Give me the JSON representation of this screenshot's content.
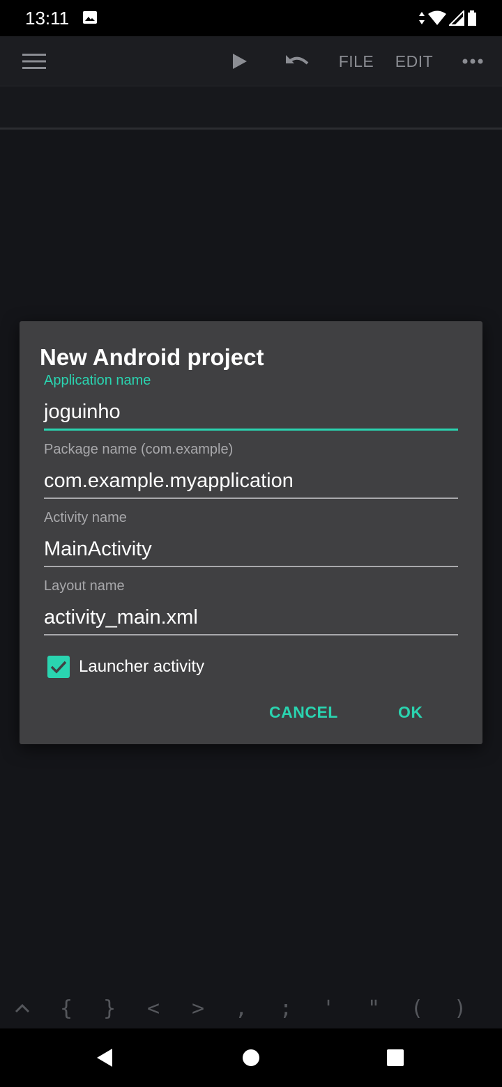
{
  "status_bar": {
    "time": "13:11"
  },
  "toolbar": {
    "file_label": "FILE",
    "edit_label": "EDIT"
  },
  "dialog": {
    "title": "New Android project",
    "fields": [
      {
        "label": "Application name",
        "value": "joguinho",
        "focused": true
      },
      {
        "label": "Package name (com.example)",
        "value": "com.example.myapplication",
        "focused": false
      },
      {
        "label": "Activity name",
        "value": "MainActivity",
        "focused": false
      },
      {
        "label": "Layout name",
        "value": "activity_main.xml",
        "focused": false
      }
    ],
    "launcher_checkbox": {
      "label": "Launcher activity",
      "checked": true
    },
    "cancel_label": "CANCEL",
    "ok_label": "OK"
  },
  "symbol_bar": {
    "symbols": [
      "{",
      "}",
      "<",
      ">",
      ",",
      ";",
      "'",
      "\"",
      "(",
      ")"
    ]
  },
  "colors": {
    "accent": "#2ad4b0",
    "dialog_bg": "#404042",
    "app_bg": "#141519"
  }
}
